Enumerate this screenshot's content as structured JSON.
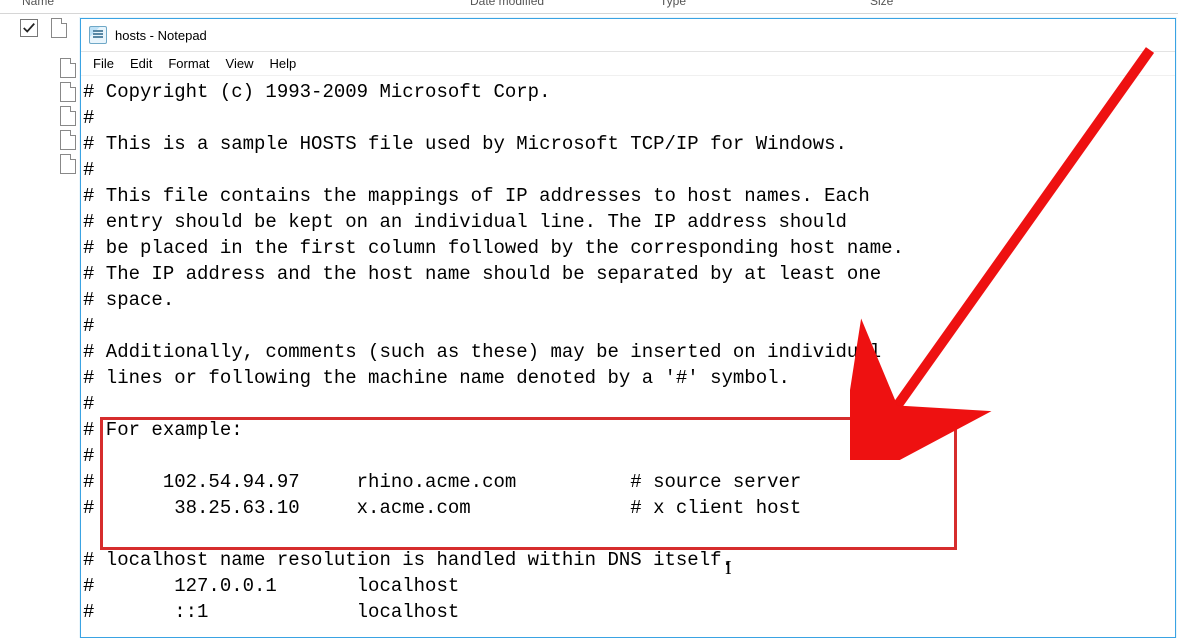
{
  "explorer": {
    "cols": {
      "name": "Name",
      "date": "Date modified",
      "type": "Type",
      "size": "Size"
    }
  },
  "window": {
    "title": "hosts - Notepad"
  },
  "menu": {
    "file": "File",
    "edit": "Edit",
    "format": "Format",
    "view": "View",
    "help": "Help"
  },
  "content": {
    "lines": [
      "# Copyright (c) 1993-2009 Microsoft Corp.",
      "#",
      "# This is a sample HOSTS file used by Microsoft TCP/IP for Windows.",
      "#",
      "# This file contains the mappings of IP addresses to host names. Each",
      "# entry should be kept on an individual line. The IP address should",
      "# be placed in the first column followed by the corresponding host name.",
      "# The IP address and the host name should be separated by at least one",
      "# space.",
      "#",
      "# Additionally, comments (such as these) may be inserted on individual",
      "# lines or following the machine name denoted by a '#' symbol.",
      "#",
      "# For example:",
      "#",
      "#      102.54.94.97     rhino.acme.com          # source server",
      "#       38.25.63.10     x.acme.com              # x client host",
      "",
      "# localhost name resolution is handled within DNS itself.",
      "#       127.0.0.1       localhost",
      "#       ::1             localhost"
    ]
  }
}
